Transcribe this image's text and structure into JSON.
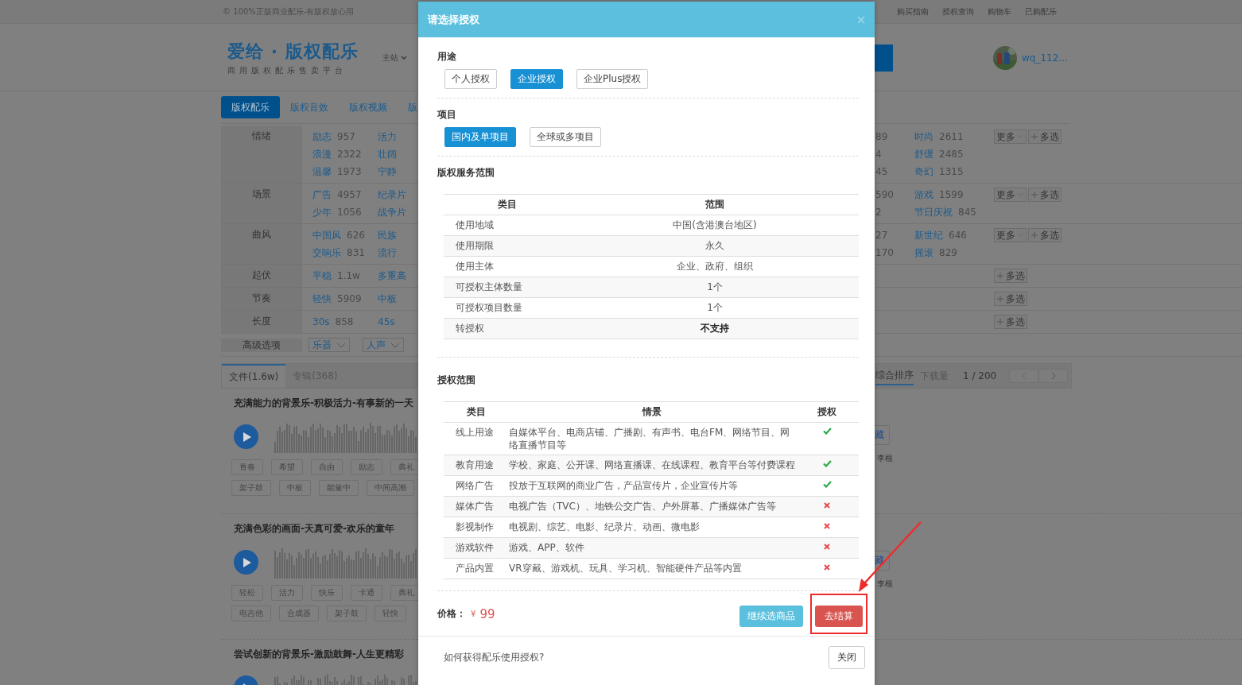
{
  "top_bar": {
    "notice": "© 100%正版商业配乐-有版权放心用",
    "links": [
      "购买指南",
      "授权查询",
      "购物车",
      "已购配乐"
    ]
  },
  "header": {
    "logo": "爱给 · 版权配乐",
    "tagline": "商用版权配乐售卖平台",
    "site_menu": "主站",
    "username": "wq_112..."
  },
  "nav_tabs": [
    {
      "label": "版权配乐",
      "selected": true
    },
    {
      "label": "版权音效",
      "selected": false
    },
    {
      "label": "版权视频",
      "selected": false
    },
    {
      "label": "版",
      "selected": false
    }
  ],
  "filters": [
    {
      "label": "情绪",
      "column_1": [
        {
          "name": "励志",
          "count": "957"
        },
        {
          "name": "浪漫",
          "count": "2322"
        },
        {
          "name": "温馨",
          "count": "1973"
        }
      ],
      "column_2": [
        "活力",
        "壮阔",
        "宁静"
      ],
      "column_3": [
        "89",
        "4",
        "45"
      ],
      "column_4": [
        {
          "name": "时尚",
          "count": "2611"
        },
        {
          "name": "舒缓",
          "count": "2485"
        },
        {
          "name": "奇幻",
          "count": "1315"
        }
      ],
      "buttons": [
        "更多",
        "多选"
      ]
    },
    {
      "label": "场景",
      "column_1": [
        {
          "name": "广告",
          "count": "4957"
        },
        {
          "name": "少年",
          "count": "1056"
        }
      ],
      "column_2": [
        "纪录片",
        "战争片"
      ],
      "column_3": [
        "590",
        "2"
      ],
      "column_4": [
        {
          "name": "游戏",
          "count": "1599"
        },
        {
          "name": "节日庆祝",
          "count": "845"
        }
      ],
      "buttons": [
        "更多",
        "多选"
      ]
    },
    {
      "label": "曲风",
      "column_1": [
        {
          "name": "中国风",
          "count": "626"
        },
        {
          "name": "交响乐",
          "count": "831"
        }
      ],
      "column_2": [
        "民族",
        "流行"
      ],
      "column_3": [
        "27",
        "170"
      ],
      "column_4": [
        {
          "name": "新世纪",
          "count": "646"
        },
        {
          "name": "摇滚",
          "count": "829"
        }
      ],
      "buttons": [
        "更多",
        "多选"
      ]
    },
    {
      "label": "起伏",
      "column_1": [
        {
          "name": "平稳",
          "count": "1.1w"
        }
      ],
      "column_2": [
        "多重高"
      ],
      "buttons": [
        "多选"
      ]
    },
    {
      "label": "节奏",
      "column_1": [
        {
          "name": "轻快",
          "count": "5909"
        }
      ],
      "column_2": [
        "中板"
      ],
      "buttons": [
        "多选"
      ]
    },
    {
      "label": "长度",
      "column_1": [
        {
          "name": "30s",
          "count": "858"
        }
      ],
      "column_2": [
        "45s"
      ],
      "buttons": [
        "多选"
      ]
    }
  ],
  "advanced": {
    "label": "高级选项",
    "dropdowns": [
      "乐器",
      "人声"
    ]
  },
  "result_tabs": [
    {
      "label": "文件(1.6w)",
      "selected": true
    },
    {
      "label": "专辑(368)",
      "selected": false
    }
  ],
  "sort_options": [
    {
      "label": "综合排序",
      "selected": true
    },
    {
      "label": "下载量",
      "selected": false
    }
  ],
  "page_info": "1 / 200",
  "tracks": [
    {
      "title": "充满能力的背景乐-积极活力-有事新的一天",
      "tags": [
        [
          "青春",
          "希望",
          "自由",
          "励志",
          "典礼"
        ],
        [
          "架子鼓",
          "中板",
          "能量中",
          "中间高潮"
        ]
      ],
      "collect": "藏",
      "author": "李根"
    },
    {
      "title": "充满色彩的画面-天真可爱-欢乐的童年",
      "tags": [
        [
          "轻松",
          "活力",
          "快乐",
          "卡通",
          "典礼"
        ],
        [
          "电吉他",
          "合成器",
          "架子鼓",
          "轻快"
        ]
      ],
      "collect": "藏",
      "author": "李根"
    },
    {
      "title": "尝试创新的背景乐-激励鼓舞-人生更精彩"
    }
  ],
  "license_dialog": {
    "title": "请选择授权",
    "sections": [
      {
        "heading": "用途",
        "options": [
          {
            "label": "个人授权",
            "selected": false
          },
          {
            "label": "企业授权",
            "selected": true
          },
          {
            "label": "企业Plus授权",
            "selected": false
          }
        ]
      },
      {
        "heading": "项目",
        "options": [
          {
            "label": "国内及单项目",
            "selected": true
          },
          {
            "label": "全球或多项目",
            "selected": false
          }
        ]
      }
    ],
    "service_scope": {
      "heading": "版权服务范围",
      "columns": [
        "类目",
        "范围"
      ],
      "rows": [
        {
          "category": "使用地域",
          "value": "中国(含港澳台地区)",
          "emphasis": false
        },
        {
          "category": "使用期限",
          "value": "永久",
          "emphasis": false
        },
        {
          "category": "使用主体",
          "value": "企业、政府、组织",
          "emphasis": false
        },
        {
          "category": "可授权主体数量",
          "value": "1个",
          "emphasis": false
        },
        {
          "category": "可授权项目数量",
          "value": "1个",
          "emphasis": false
        },
        {
          "category": "转授权",
          "value": "不支持",
          "emphasis": true
        }
      ]
    },
    "license_scope": {
      "heading": "授权范围",
      "columns": [
        "类目",
        "情景",
        "授权"
      ],
      "rows": [
        {
          "category": "线上用途",
          "scenario": "自媒体平台、电商店铺、广播剧、有声书、电台FM、网络节目、网络直播节目等",
          "authorized": true
        },
        {
          "category": "教育用途",
          "scenario": "学校、家庭、公开课、网络直播课、在线课程、教育平台等付费课程",
          "authorized": true
        },
        {
          "category": "网络广告",
          "scenario": "投放于互联网的商业广告，产品宣传片，企业宣传片等",
          "authorized": true
        },
        {
          "category": "媒体广告",
          "scenario": "电视广告（TVC）、地铁公交广告、户外屏幕、广播媒体广告等",
          "authorized": false
        },
        {
          "category": "影视制作",
          "scenario": "电视剧、综艺、电影、纪录片、动画、微电影",
          "authorized": false
        },
        {
          "category": "游戏软件",
          "scenario": "游戏、APP、软件",
          "authorized": false
        },
        {
          "category": "产品内置",
          "scenario": "VR穿戴、游戏机、玩具、学习机、智能硬件产品等内置",
          "authorized": false
        }
      ]
    },
    "price_label": "价格：",
    "currency": "¥",
    "price": "99",
    "buttons": [
      {
        "label": "继续选商品",
        "kind": "secondary",
        "highlighted": false
      },
      {
        "label": "去结算",
        "kind": "primary",
        "highlighted": true
      }
    ],
    "help_text": "如何获得配乐使用授权?",
    "close_label": "关闭"
  }
}
